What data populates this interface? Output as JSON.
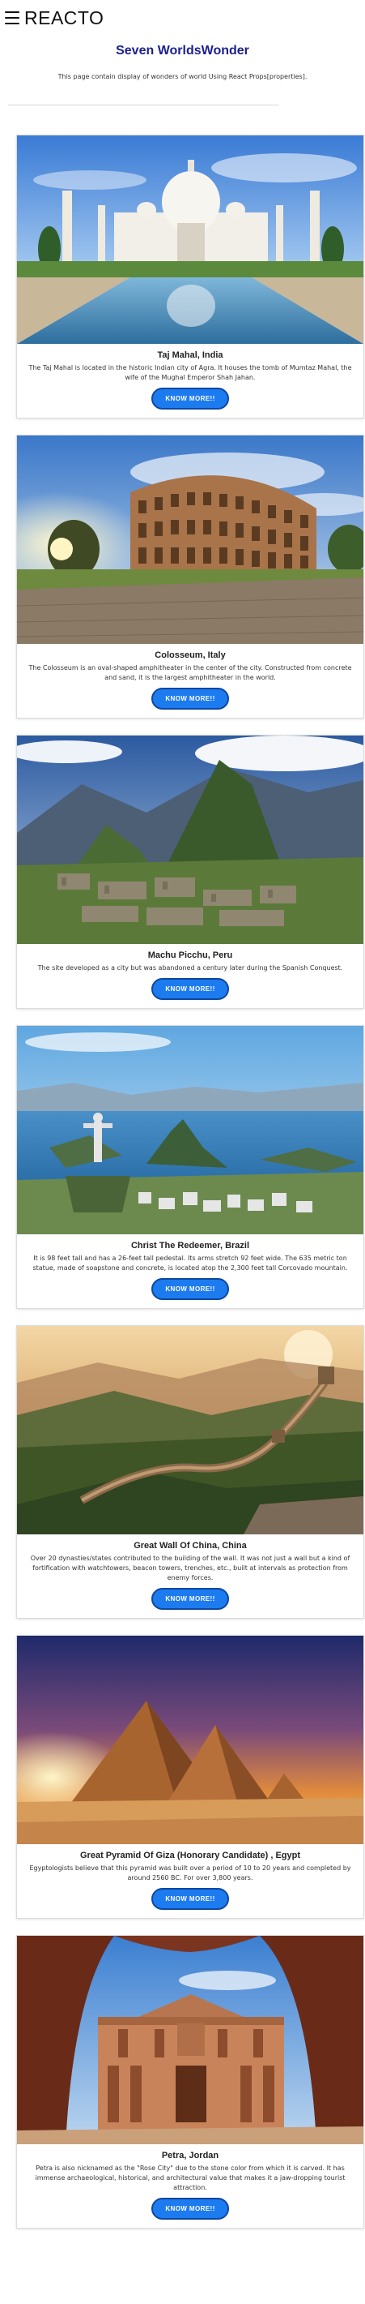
{
  "header": {
    "brand": "REACTO"
  },
  "page": {
    "title": "Seven WorldsWonder",
    "subtitle": "This page contain display of wonders of world Using React Props[properties]."
  },
  "wonders": [
    {
      "name": "Taj Mahal, India",
      "description": "The Taj Mahal is located in the historic Indian city of Agra. It houses the tomb of Mumtaz Mahal, the wife of the Mughal Emperor Shah Jahan.",
      "button": "KNOW MORE!!"
    },
    {
      "name": "Colosseum, Italy",
      "description": "The Colosseum is an oval-shaped amphitheater in the center of the city. Constructed from concrete and sand, it is the largest amphitheater in the world.",
      "button": "KNOW MORE!!"
    },
    {
      "name": "Machu Picchu, Peru",
      "description": "The site developed as a city but was abandoned a century later during the Spanish Conquest.",
      "button": "KNOW MORE!!"
    },
    {
      "name": "Christ The Redeemer, Brazil",
      "description": "It is 98 feet tall and has a 26-feet tall pedestal. Its arms stretch 92 feet wide. The 635 metric ton statue, made of soapstone and concrete, is located atop the 2,300 feet tall Corcovado mountain.",
      "button": "KNOW MORE!!"
    },
    {
      "name": "Great Wall Of China, China",
      "description": "Over 20 dynasties/states contributed to the building of the wall. It was not just a wall but a kind of fortification with watchtowers, beacon towers, trenches, etc., built at intervals as protection from enemy forces.",
      "button": "KNOW MORE!!"
    },
    {
      "name": "Great Pyramid Of Giza (Honorary Candidate) , Egypt",
      "description": "Egyptologists believe that this pyramid was built over a period of 10 to 20 years and completed by around 2560 BC. For over 3,800 years.",
      "button": "KNOW MORE!!"
    },
    {
      "name": "Petra, Jordan",
      "description": "Petra is also nicknamed as the \"Rose City\" due to the stone color from which it is carved. It has immense archaeological, historical, and architectural value that makes it a jaw-dropping tourist attraction.",
      "button": "KNOW MORE!!"
    }
  ]
}
